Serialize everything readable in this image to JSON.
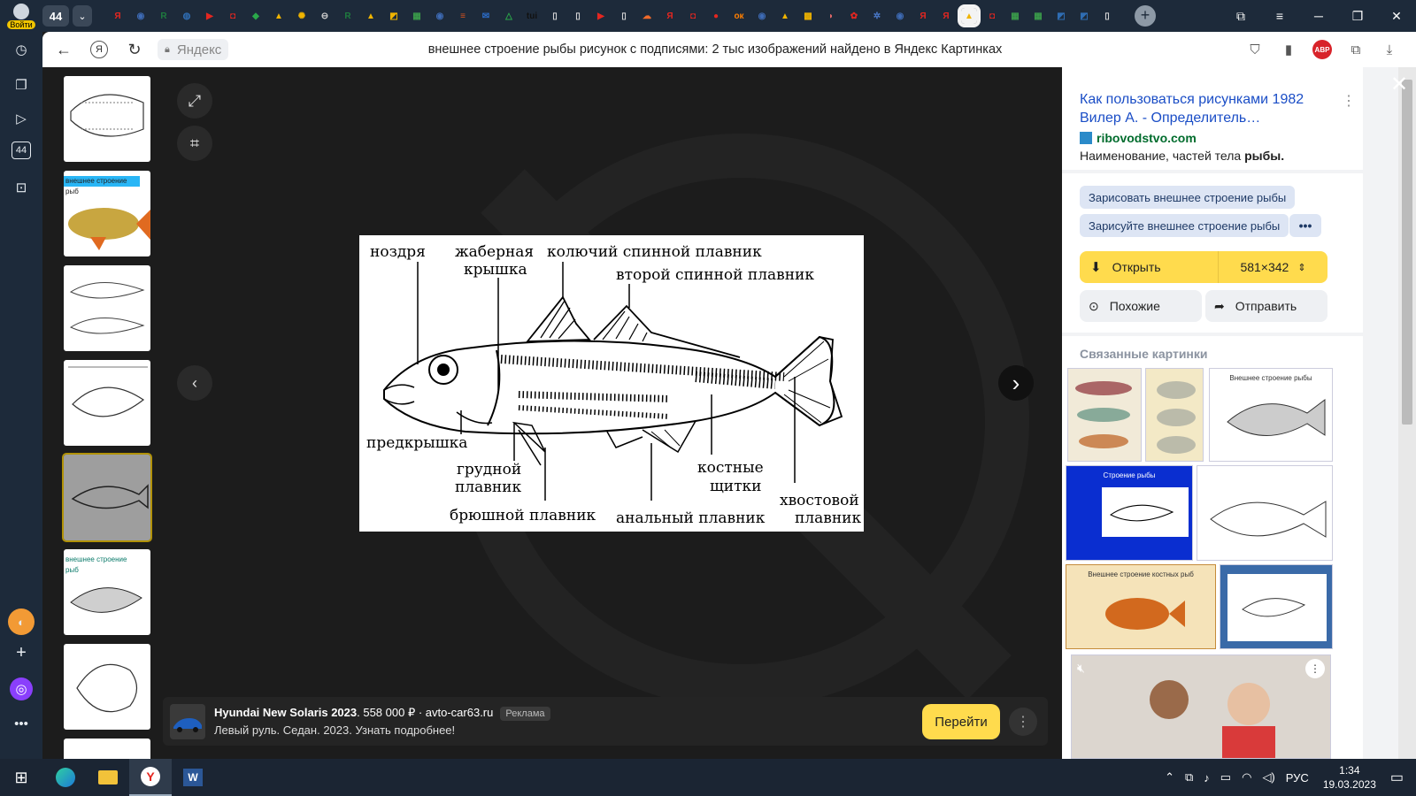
{
  "browser": {
    "login_label": "Войти",
    "tab_count": "44",
    "new_tab": "+",
    "favicons": [
      {
        "glyph": "Я",
        "color": "#e52620"
      },
      {
        "glyph": "◉",
        "color": "#3e6bb5"
      },
      {
        "glyph": "R",
        "color": "#1e7b3e"
      },
      {
        "glyph": "◍",
        "color": "#2f6db3"
      },
      {
        "glyph": "▶",
        "color": "#e52620"
      },
      {
        "glyph": "◘",
        "color": "#e52620"
      },
      {
        "glyph": "◆",
        "color": "#2aa84a"
      },
      {
        "glyph": "▲",
        "color": "#f0b400"
      },
      {
        "glyph": "✺",
        "color": "#f0b400"
      },
      {
        "glyph": "⊖",
        "color": "#cccccc"
      },
      {
        "glyph": "R",
        "color": "#1e7b3e"
      },
      {
        "glyph": "▲",
        "color": "#f0b400"
      },
      {
        "glyph": "◩",
        "color": "#f0b400"
      },
      {
        "glyph": "▦",
        "color": "#3a9b4a"
      },
      {
        "glyph": "◉",
        "color": "#3e6bb5"
      },
      {
        "glyph": "≡",
        "color": "#d9541e"
      },
      {
        "glyph": "✉",
        "color": "#2b6cc9"
      },
      {
        "glyph": "△",
        "color": "#2aa84a"
      },
      {
        "glyph": "tui",
        "color": "#111111"
      },
      {
        "glyph": "▯",
        "color": "#dddddd"
      },
      {
        "glyph": "▯",
        "color": "#dddddd"
      },
      {
        "glyph": "▶",
        "color": "#e52620"
      },
      {
        "glyph": "▯",
        "color": "#dddddd"
      },
      {
        "glyph": "☁",
        "color": "#f06a2a"
      },
      {
        "glyph": "Я",
        "color": "#e52620"
      },
      {
        "glyph": "◘",
        "color": "#e52620"
      },
      {
        "glyph": "●",
        "color": "#e52620"
      },
      {
        "glyph": "ок",
        "color": "#ff7f00"
      },
      {
        "glyph": "◉",
        "color": "#3e6bb5"
      },
      {
        "glyph": "▲",
        "color": "#f0b400"
      },
      {
        "glyph": "▩",
        "color": "#f0b400"
      },
      {
        "glyph": "◗",
        "color": "#e56a6a"
      },
      {
        "glyph": "✿",
        "color": "#e52620"
      },
      {
        "glyph": "✲",
        "color": "#4a79c9"
      },
      {
        "glyph": "◉",
        "color": "#3e6bb5"
      },
      {
        "glyph": "Я",
        "color": "#e52620"
      },
      {
        "glyph": "Я",
        "color": "#e52620"
      },
      {
        "glyph": "▲",
        "color": "#f0b400"
      },
      {
        "glyph": "◘",
        "color": "#e52620"
      },
      {
        "glyph": "▦",
        "color": "#3a9b4a"
      },
      {
        "glyph": "▦",
        "color": "#3a9b4a"
      },
      {
        "glyph": "◩",
        "color": "#2f6db3"
      },
      {
        "glyph": "◩",
        "color": "#2f6db3"
      },
      {
        "glyph": "▯",
        "color": "#dddddd"
      }
    ],
    "address_short": "Яндекс",
    "page_title": "внешнее строение рыбы рисунок с подписями: 2 тыс изображений найдено в Яндекс Картинках",
    "adblock_label": "ABP"
  },
  "viewer": {
    "fish_labels": {
      "nostril": "ноздря",
      "gill_cover_1": "жаберная",
      "gill_cover_2": "крышка",
      "spiny_dorsal": "колючий спинной плавник",
      "second_dorsal": "второй спинной плавник",
      "preopercle": "предкрышка",
      "pectoral_1": "грудной",
      "pectoral_2": "плавник",
      "ventral": "брюшной плавник",
      "anal": "анальный плавник",
      "scutes_1": "костные",
      "scutes_2": "щитки",
      "caudal_1": "хвостовой",
      "caudal_2": "плавник"
    },
    "thumb_strips": [
      "внешнее строение рыб",
      "внешнее строение рыб"
    ],
    "ad": {
      "title": "Hyundai New Solaris 2023",
      "price": ". 558 000 ₽ · avto-car63.ru",
      "tag": "Реклама",
      "subtitle": "Левый руль. Седан. 2023. Узнать подробнее!",
      "button": "Перейти"
    }
  },
  "panel": {
    "source_title": "Как пользоваться рисунками 1982 Вилер А. - Определитель…",
    "source_domain": "ribovodstvo.com",
    "source_desc_plain": "Наименование, частей тела ",
    "source_desc_bold": "рыбы.",
    "chips": [
      "Зарисовать внешнее строение рыбы",
      "Зарисуйте внешнее строение рыбы"
    ],
    "open_label": "Открыть",
    "size_label": "581×342",
    "similar_label": "Похожие",
    "send_label": "Отправить",
    "related_heading": "Связанные картинки",
    "related_captions": [
      "Внешнее строение рыбы",
      "Строение рыбы",
      "Внешнее строение костных рыб"
    ]
  },
  "taskbar": {
    "lang": "РУС",
    "time": "1:34",
    "date": "19.03.2023"
  },
  "colors": {
    "accent_yellow": "#ffdb4d",
    "link_blue": "#1a4dc6",
    "domain_green": "#006c2d"
  }
}
